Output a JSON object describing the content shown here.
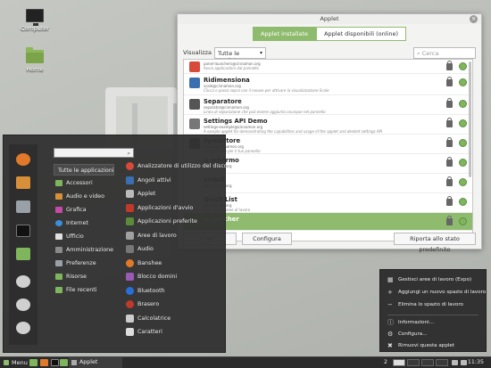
{
  "desktop": {
    "icons": [
      {
        "label": "Computer"
      },
      {
        "label": "Home"
      }
    ]
  },
  "window": {
    "title": "Applet",
    "tabs": [
      {
        "label": "Applet installate",
        "active": true
      },
      {
        "label": "Applet disponibili (online)",
        "active": false
      }
    ],
    "filter_label": "Visualizza",
    "filter_value": "Tutte le applets",
    "search_placeholder": "Cerca",
    "applets": [
      {
        "name": "",
        "uuid": "panel-launchers@cinnamon.org",
        "desc": "Avvia applicazioni dal pannello",
        "color": "#d84a3a"
      },
      {
        "name": "Ridimensiona",
        "uuid": "scale@cinnamon.org",
        "desc": "Clicca o passa sopra con il mouse per attivare la visualizzazione Scale",
        "color": "#3a6fb0"
      },
      {
        "name": "Separatore",
        "uuid": "separator@cinnamon.org",
        "desc": "Linea di separazione che può essere aggiunta ovunque nel pannello",
        "color": "#555555"
      },
      {
        "name": "Settings API Demo",
        "uuid": "settings-example@cinnamon.org",
        "desc": "A sample applet for demonstrating the capabilities and usage of the applet and desklet settings API",
        "color": "#777777"
      },
      {
        "name": "Spaziatore",
        "uuid": "spacer@cinnamon.org",
        "desc": "Spazio vuoto per il tuo pannello",
        "color": "#333333"
      },
      {
        "name": "u schermo",
        "uuid": "@cinnamon.org",
        "desc": "",
        "color": "#888888"
      },
      {
        "name": "ovibili",
        "uuid": "@cinnamon.org",
        "desc": "",
        "color": "#888888"
      },
      {
        "name": "Quick List",
        "uuid": "@cinnamon.org",
        "desc": "...di tutte le aree di lavoro",
        "color": "#888888"
      },
      {
        "name": "e switcher",
        "uuid": "",
        "desc": "",
        "color": "#888888",
        "selected": true
      }
    ],
    "buttons": {
      "partial_left": "lo",
      "configure": "Configura",
      "reset": "Riporta allo stato predefinito"
    }
  },
  "menu": {
    "search_placeholder": "",
    "categories": [
      {
        "label": "Tutte le applicazioni",
        "color": "",
        "active": true
      },
      {
        "label": "Accessori",
        "color": "#7fb55d"
      },
      {
        "label": "Audio e video",
        "color": "#d88f3a"
      },
      {
        "label": "Grafica",
        "color": "#c84aa8"
      },
      {
        "label": "Internet",
        "color": "#3a8fd8"
      },
      {
        "label": "Ufficio",
        "color": "#e0e0e0"
      },
      {
        "label": "Amministrazione",
        "color": "#8a8a8a"
      },
      {
        "label": "Preferenze",
        "color": "#9aa0a8"
      },
      {
        "label": "Risorse",
        "color": "#7fb55d"
      },
      {
        "label": "File recenti",
        "color": "#7fb55d"
      }
    ],
    "apps": [
      {
        "label": "Analizzatore di utilizzo del disco",
        "color": "#d84a3a"
      },
      {
        "label": "Angoli attivi",
        "color": "#3a6fb0"
      },
      {
        "label": "Applet",
        "color": "#bbbbbb"
      },
      {
        "label": "Applicazioni d'avvio",
        "color": "#c0392b"
      },
      {
        "label": "Applicazioni preferite",
        "color": "#5a8a3a"
      },
      {
        "label": "Aree di lavoro",
        "color": "#a0a0a0"
      },
      {
        "label": "Audio",
        "color": "#777777"
      },
      {
        "label": "Banshee",
        "color": "#e07a2a"
      },
      {
        "label": "Blocco domini",
        "color": "#9b59b6"
      },
      {
        "label": "Bluetooth",
        "color": "#2a6fd8"
      },
      {
        "label": "Brasero",
        "color": "#c0392b"
      },
      {
        "label": "Calcolatrice",
        "color": "#cccccc"
      },
      {
        "label": "Caratteri",
        "color": "#dddddd"
      }
    ],
    "favorites": [
      {
        "icon": "firefox-icon",
        "color": "#e07a2a"
      },
      {
        "icon": "software-manager-icon",
        "color": "#d88f3a"
      },
      {
        "icon": "system-settings-icon",
        "color": "#9aa0a8"
      },
      {
        "icon": "terminal-icon",
        "color": "#222222"
      },
      {
        "icon": "files-icon",
        "color": "#7fb55d"
      },
      {
        "icon": "lock-screen-icon",
        "color": "#d0d0d0"
      },
      {
        "icon": "logout-icon",
        "color": "#d0d0d0"
      },
      {
        "icon": "shutdown-icon",
        "color": "#d0d0d0"
      }
    ]
  },
  "context_menu": {
    "items": [
      {
        "label": "Gestisci aree di lavoro (Expo)",
        "symbol": "▦"
      },
      {
        "label": "Aggiungi un nuovo spazio di lavoro",
        "symbol": "+"
      },
      {
        "label": "Elimina lo spazio di lavoro",
        "symbol": "−"
      },
      {
        "label": "Informazioni...",
        "symbol": "ⓘ"
      },
      {
        "label": "Configura...",
        "symbol": "⚙"
      },
      {
        "label": "Rimuovi questa applet",
        "symbol": "✖"
      }
    ]
  },
  "panel": {
    "menu_label": "Menu",
    "task_label": "Applet",
    "workspace_count": "2",
    "clock": "11:35"
  }
}
